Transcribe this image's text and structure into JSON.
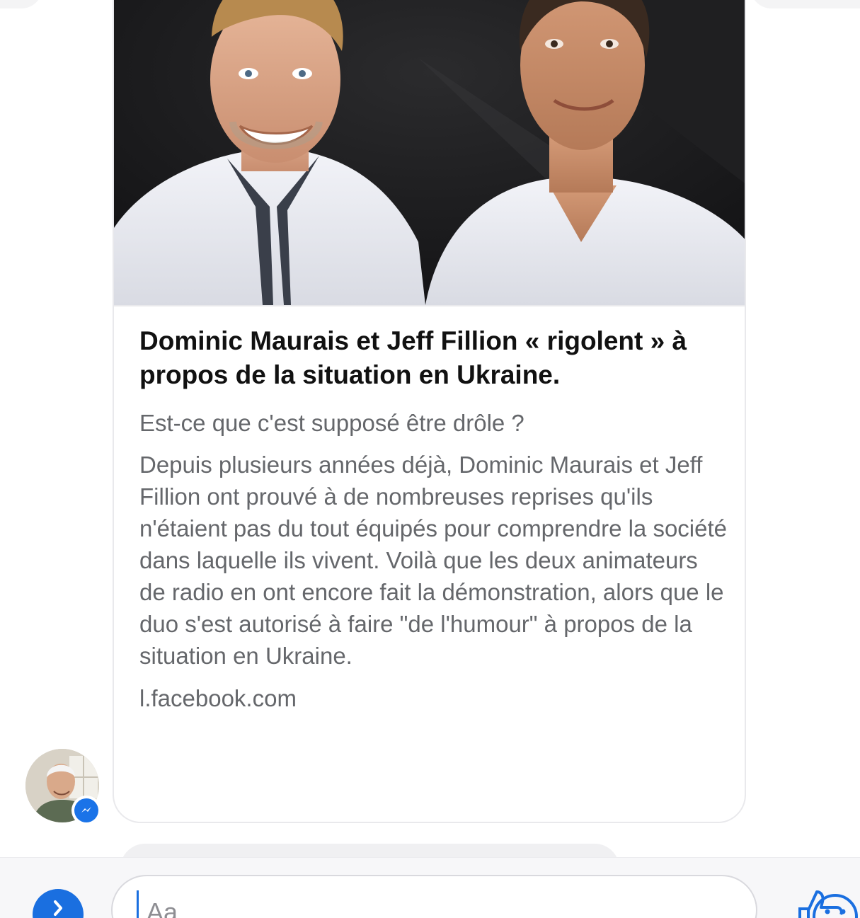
{
  "link_card": {
    "title": "Dominic Maurais et Jeff Fillion « rigolent » à propos de la situation en Ukraine.",
    "subtitle": "Est-ce que c'est supposé être drôle ?",
    "description": "Depuis plusieurs années déjà, Dominic Maurais et Jeff Fillion ont prouvé à de nombreuses reprises qu'ils n'étaient pas du tout équipés pour comprendre la société dans laquelle ils vivent. Voilà que les deux animateurs de radio en ont encore fait la démonstration, alors que le duo s'est autorisé à faire \"de l'humour\" à propos de la situation en Ukraine.",
    "domain": "l.facebook.com",
    "image_icon": "two-men-photo"
  },
  "sender": {
    "avatar_icon": "user-avatar",
    "badge_icon": "messenger-icon"
  },
  "composer": {
    "placeholder": "Aa",
    "expand_icon": "chevron-right-icon",
    "emoji_icon": "smiley-icon",
    "like_icon": "thumbs-up-icon"
  },
  "colors": {
    "accent": "#1a6fe0",
    "secondary_text": "#65676b",
    "title_text": "#111111"
  }
}
